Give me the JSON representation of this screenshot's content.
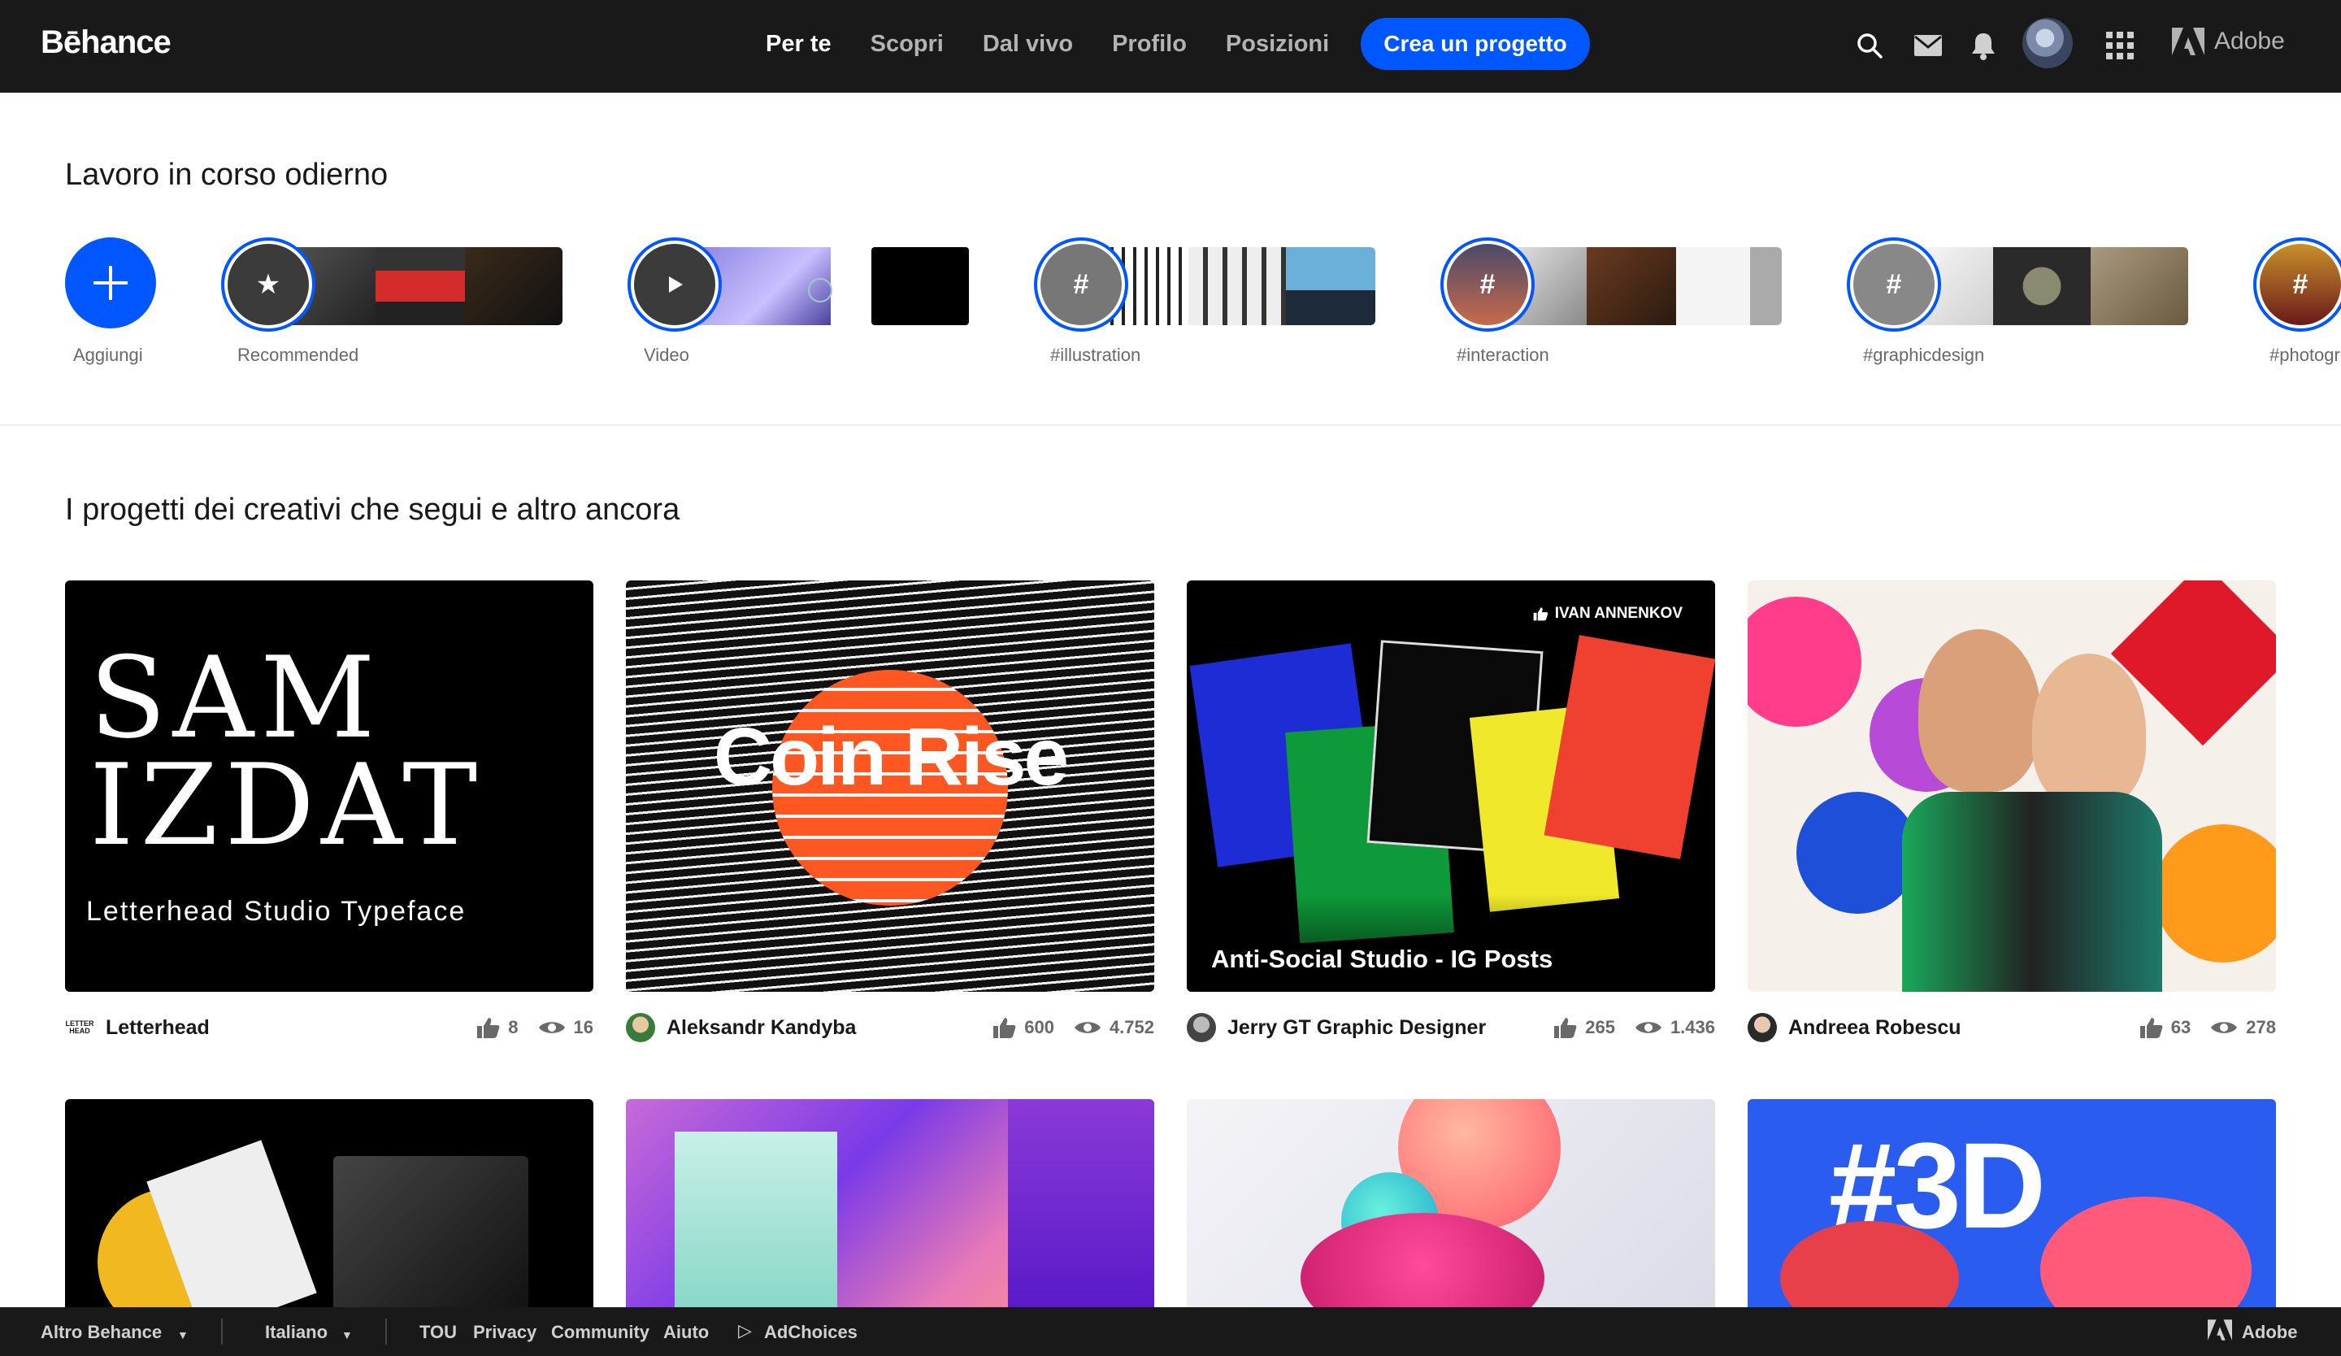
{
  "brand": {
    "logo": "Bēhance",
    "adobe": "Adobe"
  },
  "nav": {
    "items": [
      {
        "label": "Per te",
        "active": true
      },
      {
        "label": "Scopri",
        "active": false
      },
      {
        "label": "Dal vivo",
        "active": false
      },
      {
        "label": "Profilo",
        "active": false
      },
      {
        "label": "Posizioni",
        "active": false
      }
    ],
    "cta": "Crea un progetto",
    "icons": [
      "search-icon",
      "mail-icon",
      "bell-icon",
      "avatar",
      "apps-grid-icon"
    ]
  },
  "stories": {
    "title": "Lavoro in corso odierno",
    "add_label": "Aggiungi",
    "items": [
      {
        "label": "Recommended",
        "icon": "star-icon"
      },
      {
        "label": "Video",
        "icon": "play-icon"
      },
      {
        "label": "#illustration",
        "icon": "hashtag-icon"
      },
      {
        "label": "#interaction",
        "icon": "hashtag-icon"
      },
      {
        "label": "#graphicdesign",
        "icon": "hashtag-icon"
      },
      {
        "label": "#photogr",
        "icon": "hashtag-icon"
      }
    ]
  },
  "projects": {
    "title": "I progetti dei creativi che segui e altro ancora",
    "cards": [
      {
        "cover_title_1": "SAM",
        "cover_title_2": "IZDAT",
        "cover_sub": "Letterhead Studio Typeface",
        "owner": "Letterhead",
        "owner_badge": "LETTER HEAD",
        "likes": "8",
        "views": "16"
      },
      {
        "cover_title": "Coin Rise",
        "owner": "Aleksandr Kandyba",
        "likes": "600",
        "views": "4.752"
      },
      {
        "cover_title": "Anti-Social Studio - IG Posts",
        "featured_by": "IVAN ANNENKOV",
        "owner": "Jerry GT Graphic Designer",
        "likes": "265",
        "views": "1.436"
      },
      {
        "owner": "Andreea Robescu",
        "likes": "63",
        "views": "278"
      }
    ],
    "row2": [
      {
        "cover_text": ""
      },
      {
        "cover_text": ""
      },
      {
        "cover_text": ""
      },
      {
        "cover_text": "#3D"
      }
    ]
  },
  "footer": {
    "more": "Altro Behance",
    "language": "Italiano",
    "links": [
      "TOU",
      "Privacy",
      "Community",
      "Aiuto"
    ],
    "adchoices": "AdChoices",
    "adobe": "Adobe"
  },
  "colors": {
    "accent": "#0057ff",
    "topbar": "#191919"
  }
}
